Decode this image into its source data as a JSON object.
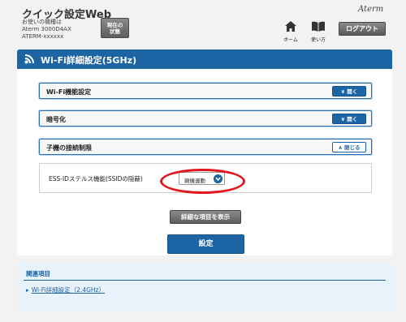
{
  "header": {
    "app_title": "クイック設定Web",
    "device_line1": "お使いの機種は",
    "device_line2": "Aterm 3000D4AX",
    "device_line3": "ATERM-xxxxxx",
    "status_line1": "現在の",
    "status_line2": "状態",
    "home_label": "ホーム",
    "manual_label": "使い方",
    "logo": "Aterm",
    "logout_label": "ログアウト"
  },
  "panel": {
    "title": "Wi-Fi詳細設定(5GHz)"
  },
  "sections": [
    {
      "label": "Wi-Fi機能設定",
      "toggle": "開く",
      "state": "collapsed"
    },
    {
      "label": "暗号化",
      "toggle": "開く",
      "state": "collapsed"
    },
    {
      "label": "子機の接続制限",
      "toggle": "閉じる",
      "state": "expanded"
    }
  ],
  "setting": {
    "label": "ESS-IDステルス機能(SSIDの隠蔽)",
    "value": "親機連動"
  },
  "buttons": {
    "detail": "詳細な項目を表示",
    "apply": "設定"
  },
  "related": {
    "title": "関連項目",
    "link": "Wi-Fi詳細設定（2.4GHz）"
  },
  "colors": {
    "accent": "#1d64a4",
    "highlight": "#e0161c",
    "background": "#f2f2f2"
  }
}
